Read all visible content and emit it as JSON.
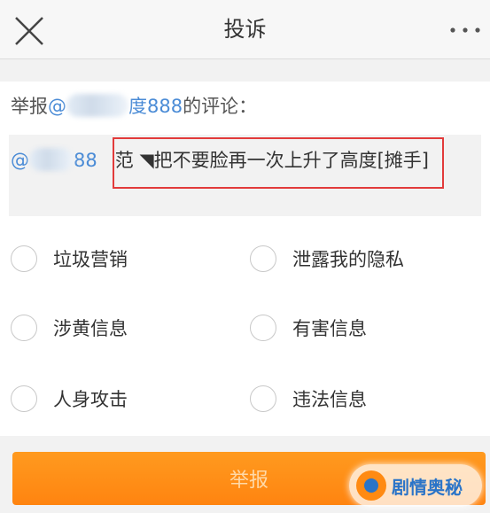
{
  "header": {
    "title": "投诉",
    "close_icon": "close-icon",
    "more_icon": "more-dots-icon"
  },
  "report": {
    "prefix": "举报",
    "mention_at": "@",
    "mention_visible": "度888",
    "suffix": "的评论："
  },
  "quote": {
    "mention_at": "@",
    "mention_visible": "88",
    "comment": "范 ◥把不要脸再一次上升了高度[摊手]"
  },
  "options": [
    {
      "label": "垃圾营销"
    },
    {
      "label": "泄露我的隐私"
    },
    {
      "label": "涉黄信息"
    },
    {
      "label": "有害信息"
    },
    {
      "label": "人身攻击"
    },
    {
      "label": "违法信息"
    }
  ],
  "submit": {
    "label": "举报"
  },
  "watermark": {
    "text": "剧情奥秘"
  },
  "colors": {
    "accent": "#ff8a12",
    "mention": "#4a8bd6",
    "highlight": "#e23b3b"
  }
}
